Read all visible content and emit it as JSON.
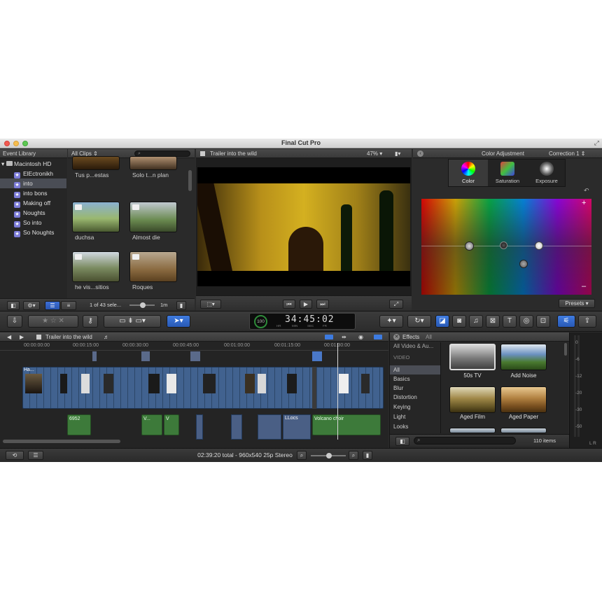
{
  "window": {
    "title": "Final Cut Pro"
  },
  "event_library": {
    "header": "Event Library",
    "drive": "Macintosh HD",
    "items": [
      "ElEctronikh",
      "into",
      "into bons",
      "Making off",
      "Noughts",
      "So into",
      "So Noughts"
    ],
    "selected_index": 1
  },
  "browser": {
    "filter": "All Clips",
    "clips": [
      "Tus p...estas",
      "Solo t...n plan",
      "duchsa",
      "Almost die",
      "he vis...sitios",
      "Roques"
    ],
    "selection_status": "1 of 43 sele...",
    "duration_label": "1m"
  },
  "viewer": {
    "title": "Trailer into the wild",
    "zoom": "47%"
  },
  "inspector": {
    "title": "Color Adjustment",
    "correction": "Correction 1",
    "tabs": [
      "Color",
      "Saturation",
      "Exposure"
    ],
    "presets": "Presets"
  },
  "toolbar": {
    "timecode": "34:45:02",
    "timecode_badge": "100",
    "timecode_units": [
      "HR",
      "MIN",
      "SEC",
      "FR"
    ]
  },
  "timeline": {
    "project": "Trailer into the wild",
    "ruler": [
      "00:00:00:00",
      "00:00:15:00",
      "00:00:30:00",
      "00:00:45:00",
      "00:01:00:00",
      "00:01:15:00",
      "00:01:30:00"
    ],
    "audio_labels": [
      "6952",
      "V...",
      "V",
      "LLocs",
      "Volcano choir"
    ],
    "video_label": "Ha...",
    "status": "02:39:20 total - 960x540 25p Stereo"
  },
  "effects": {
    "header": "Effects",
    "header_all": "All",
    "filter": "All Video & Au...",
    "section": "VIDEO",
    "categories": [
      "All",
      "Basics",
      "Blur",
      "Distortion",
      "Keying",
      "Light",
      "Looks"
    ],
    "items": [
      "50s TV",
      "Add Noise",
      "Aged Film",
      "Aged Paper"
    ],
    "count": "110 items"
  },
  "meters": {
    "labels": [
      "0",
      "-6",
      "-12",
      "-20",
      "-30",
      "-50"
    ],
    "channels": "L R"
  }
}
